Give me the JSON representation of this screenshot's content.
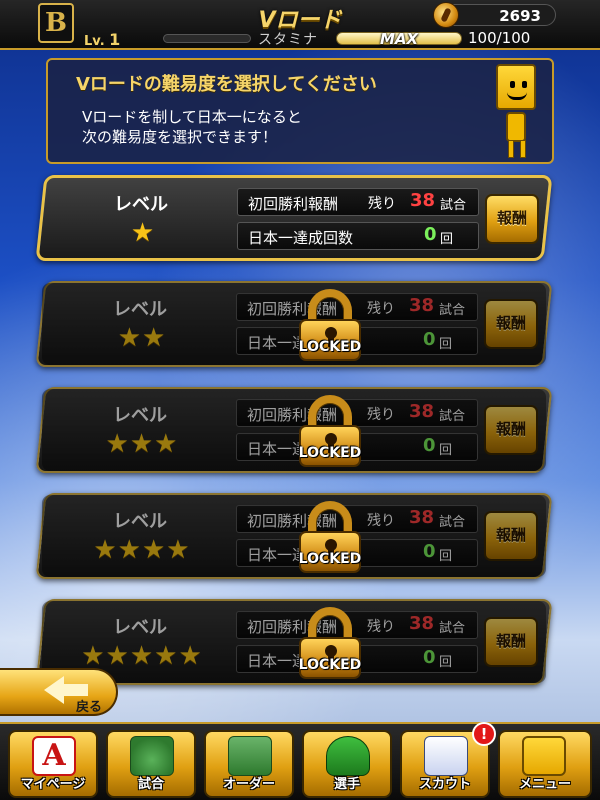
{
  "header": {
    "team_logo_letter": "B",
    "title": "Vロード",
    "gold": "2693",
    "level_prefix": "Lv.",
    "level": "1",
    "stamina_label": "スタミナ",
    "stamina_max_label": "MAX",
    "stamina_value": "100/100",
    "colors": {
      "accent_gold": "#c79b2a",
      "title": "#f6d56a"
    }
  },
  "info": {
    "title": "Vロードの難易度を選択してください",
    "line1": "Vロードを制して日本一になると",
    "line2": "次の難易度を選択できます！",
    "mascot_icon": "yellow-square-mascot-icon"
  },
  "common": {
    "level_label": "レベル",
    "first_win_reward_label": "初回勝利報酬",
    "remaining_label": "残り",
    "games_unit": "試合",
    "champion_count_label": "日本一達成回数",
    "count_unit": "回",
    "reward_button": "報酬",
    "locked_label": "LOCKED",
    "remaining_color": "#ff4242",
    "champion_color": "#7bf05b"
  },
  "levels": [
    {
      "stars": "★",
      "star_count": 1,
      "remaining": "38",
      "champion_count": "0",
      "locked": false
    },
    {
      "stars": "★★",
      "star_count": 2,
      "remaining": "38",
      "champion_count": "0",
      "locked": true
    },
    {
      "stars": "★★★",
      "star_count": 3,
      "remaining": "38",
      "champion_count": "0",
      "locked": true
    },
    {
      "stars": "★★★★",
      "star_count": 4,
      "remaining": "38",
      "champion_count": "0",
      "locked": true
    },
    {
      "stars": "★★★★★",
      "star_count": 5,
      "remaining": "38",
      "champion_count": "0",
      "locked": true
    }
  ],
  "back_button": {
    "label": "戻る",
    "icon": "back-arrow-icon"
  },
  "nav": {
    "items": [
      {
        "label": "マイページ",
        "icon": "letter-a-icon",
        "glyph": "A"
      },
      {
        "label": "試合",
        "icon": "stadium-icon"
      },
      {
        "label": "オーダー",
        "icon": "order-field-icon"
      },
      {
        "label": "選手",
        "icon": "player-icon"
      },
      {
        "label": "スカウト",
        "icon": "scout-icon",
        "badge": "!"
      },
      {
        "label": "メニュー",
        "icon": "menu-mascot-icon"
      }
    ]
  }
}
